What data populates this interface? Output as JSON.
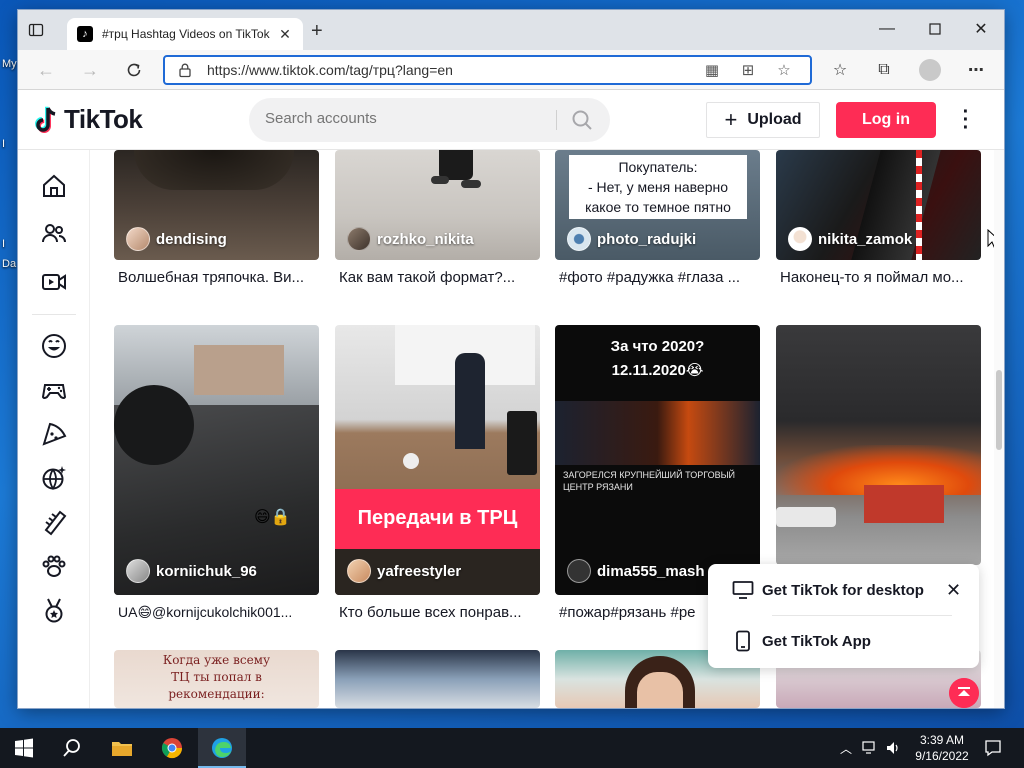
{
  "desktop": {
    "labels": [
      "My",
      "I",
      "I",
      "Da"
    ]
  },
  "browser": {
    "tab_title": "#трц Hashtag Videos on TikTok",
    "url": "https://www.tiktok.com/tag/трц?lang=en"
  },
  "header": {
    "logo_text": "TikTok",
    "search_placeholder": "Search accounts",
    "upload_label": "Upload",
    "login_label": "Log in"
  },
  "videos": [
    {
      "author": "dendising",
      "caption": "Волшебная тряпочка. Ви..."
    },
    {
      "author": "rozhko_nikita",
      "caption": "Как вам такой формат?..."
    },
    {
      "author": "photo_radujki",
      "caption": "#фото #радужка #глаза ...",
      "overlay": "Покупатель:\n- Нет, у меня наверно\nкакое то темное пятно"
    },
    {
      "author": "nikita_zamok",
      "caption": "Наконец-то я поймал мо..."
    },
    {
      "author": "korniichuk_96",
      "caption": "UA😄@kornijcukolchik001..."
    },
    {
      "author": "yafreestyler",
      "caption": "Кто больше всех понрав...",
      "overlay": "Передачи в ТРЦ"
    },
    {
      "author": "dima555_mash",
      "caption": "#пожар#рязань #ре",
      "overlay": "За что 2020?\n12.11.2020😭",
      "overlay_small": "ЗАГОРЕЛСЯ КРУПНЕЙШИЙ ТОРГОВЫЙ ЦЕНТР РЯЗАНИ"
    },
    {
      "author": "",
      "caption": ""
    }
  ],
  "row3_overlay": "Когда уже всему\nТЦ ты попал в\nрекомендации:",
  "popup": {
    "desktop_label": "Get TikTok for desktop",
    "app_label": "Get TikTok App"
  },
  "taskbar": {
    "time": "3:39 AM",
    "date": "9/16/2022"
  }
}
